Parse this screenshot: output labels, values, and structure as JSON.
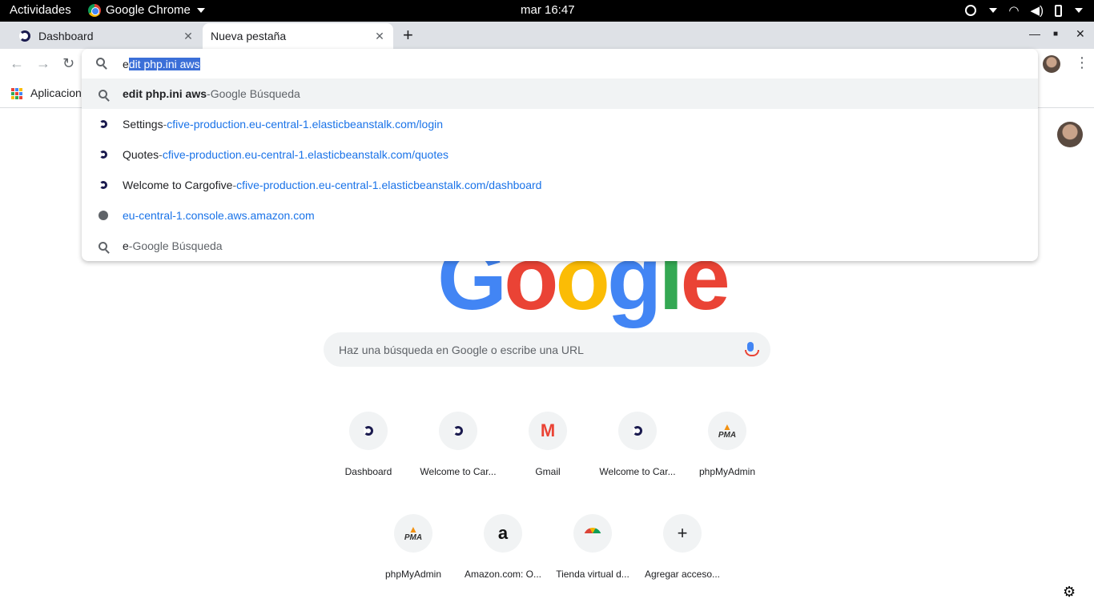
{
  "topbar": {
    "activities": "Actividades",
    "app_name": "Google Chrome",
    "clock": "mar 16:47"
  },
  "tabs": [
    {
      "title": "Dashboard",
      "active": false
    },
    {
      "title": "Nueva pestaña",
      "active": true
    }
  ],
  "bookmarks": {
    "apps_label": "Aplicaciones"
  },
  "omnibox": {
    "typed": "e",
    "autocomplete_selected": "dit php.ini aws",
    "suggestions": [
      {
        "icon": "search-icon",
        "bold": "edit php.ini aws",
        "sep": " - ",
        "extra": "Google Búsqueda"
      },
      {
        "icon": "cargofive-icon",
        "bold": "Settings",
        "sep": " - ",
        "extra": "cfive-production.eu-central-1.elasticbeanstalk.com/login"
      },
      {
        "icon": "cargofive-icon",
        "bold": "Quotes",
        "sep": " - ",
        "extra": "cfive-production.eu-central-1.elasticbeanstalk.com/quotes"
      },
      {
        "icon": "cargofive-icon",
        "bold": "Welcome to Cargofive",
        "sep": " - ",
        "extra": "cfive-production.eu-central-1.elasticbeanstalk.com/dashboard"
      },
      {
        "icon": "globe-icon",
        "bold": "",
        "sep": "",
        "extra": "eu-central-1.console.aws.amazon.com"
      },
      {
        "icon": "search-icon",
        "bold": "e",
        "sep": " - ",
        "extra": "Google Búsqueda"
      }
    ]
  },
  "logo_letters": [
    "G",
    "o",
    "o",
    "g",
    "l",
    "e"
  ],
  "search_placeholder": "Haz una búsqueda en Google o escribe una URL",
  "shortcuts": [
    {
      "label": "Dashboard",
      "icon": "cargofive-icon"
    },
    {
      "label": "Welcome to Car...",
      "icon": "cargofive-icon"
    },
    {
      "label": "Gmail",
      "icon": "gmail-icon"
    },
    {
      "label": "Welcome to Car...",
      "icon": "cargofive-icon"
    },
    {
      "label": "phpMyAdmin",
      "icon": "phpmyadmin-icon"
    },
    {
      "label": "phpMyAdmin",
      "icon": "phpmyadmin-icon"
    },
    {
      "label": "Amazon.com: O...",
      "icon": "amazon-icon"
    },
    {
      "label": "Tienda virtual d...",
      "icon": "chrome-store-icon"
    },
    {
      "label": "Agregar acceso...",
      "icon": "add-icon"
    }
  ],
  "icon_glyphs": {
    "gmail": "M",
    "pma": "PMA",
    "amazon": "a",
    "plus": "+"
  }
}
